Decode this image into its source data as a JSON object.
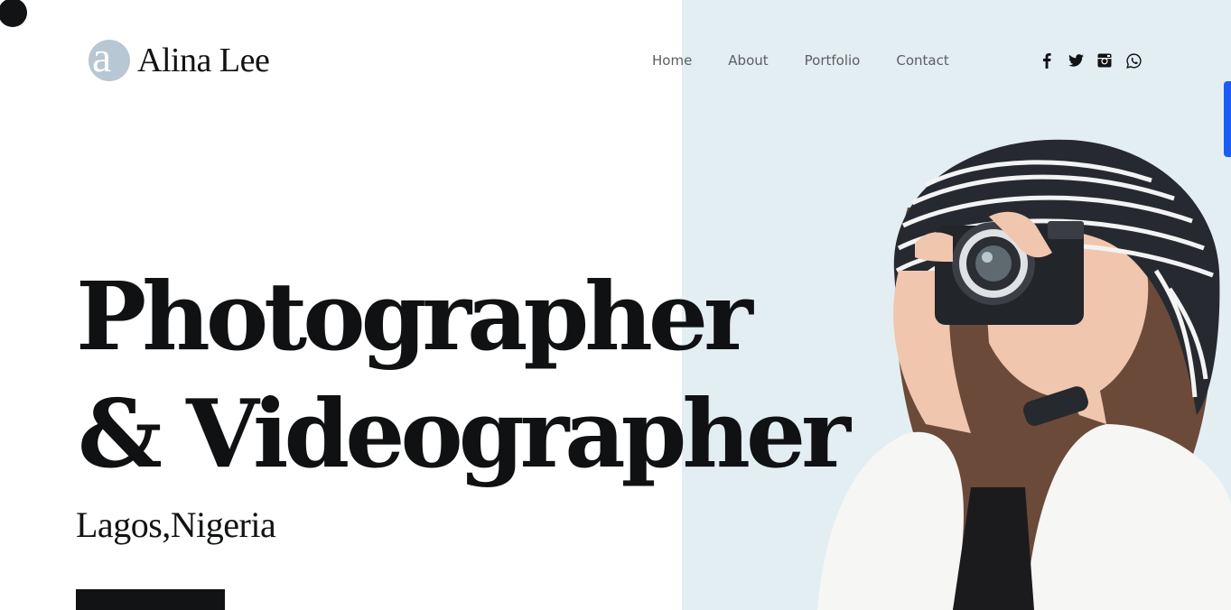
{
  "brand": {
    "logo_letter": "a",
    "name": "Alina Lee",
    "accent": "#b7c7d3"
  },
  "nav": {
    "items": [
      "Home",
      "About",
      "Portfolio",
      "Contact"
    ]
  },
  "social": [
    "facebook-icon",
    "twitter-icon",
    "instagram-icon",
    "whatsapp-icon"
  ],
  "hero": {
    "line1": "Photographer",
    "line2": "& Videographer",
    "location": "Lagos,Nigeria"
  },
  "colors": {
    "text": "#111315",
    "photo_bg": "#e3eef3",
    "side_tab": "#1a5cf5"
  }
}
